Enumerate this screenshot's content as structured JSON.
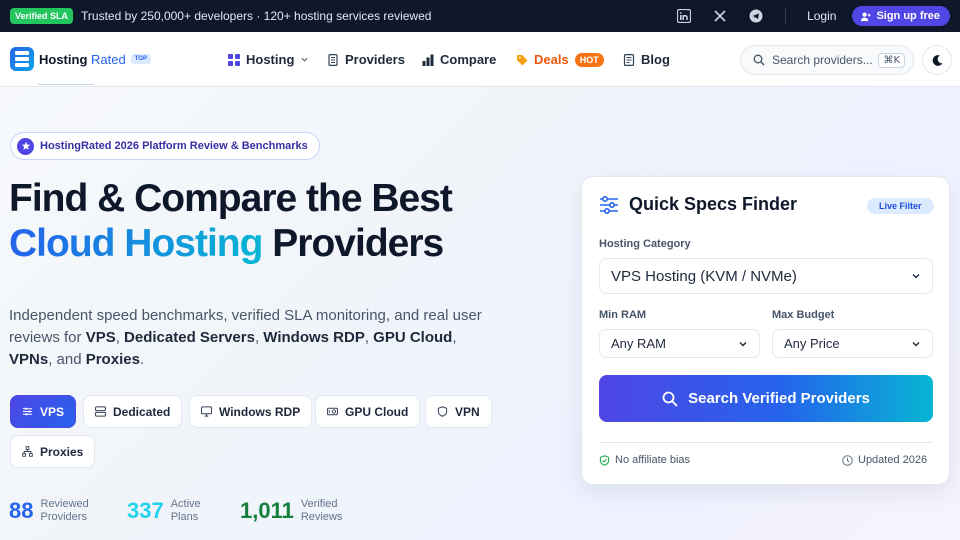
{
  "topbar": {
    "badge": "Verified SLA",
    "trust_text": "Trusted by 250,000+ developers · 120+ hosting services reviewed",
    "social_icons": [
      "linkedin-icon",
      "x-icon",
      "telegram-icon"
    ],
    "login_label": "Login",
    "signup_label": "Sign up free"
  },
  "nav": {
    "logo_primary": "Hosting",
    "logo_secondary": "Rated",
    "logo_badge": "TOP",
    "items": [
      {
        "label": "Hosting",
        "icon": "grid-icon"
      },
      {
        "label": "Providers",
        "icon": "server-icon"
      },
      {
        "label": "Compare",
        "icon": "bar-chart-icon"
      },
      {
        "label": "Deals",
        "icon": "tag-icon",
        "badge": "HOT"
      },
      {
        "label": "Blog",
        "icon": "document-icon"
      }
    ],
    "search_placeholder": "Search providers...",
    "search_shortcut": "⌘K"
  },
  "hero": {
    "pill": "HostingRated 2026 Platform Review & Benchmarks",
    "title_line1": "Find & Compare the Best",
    "title_highlight": "Cloud Hosting",
    "title_rest": "Providers",
    "desc_intro": "Independent speed benchmarks, verified SLA monitoring, and real user reviews for ",
    "desc_terms": [
      "VPS",
      "Dedicated Servers",
      "Windows RDP",
      "GPU Cloud",
      "VPNs",
      "Proxies"
    ],
    "desc_sep1": ", ",
    "desc_sep_last": ", and ",
    "desc_end": ".",
    "chips": [
      {
        "label": "VPS",
        "active": true
      },
      {
        "label": "Dedicated",
        "active": false
      },
      {
        "label": "Windows RDP",
        "active": false
      },
      {
        "label": "GPU Cloud",
        "active": false
      },
      {
        "label": "VPN",
        "active": false
      },
      {
        "label": "Proxies",
        "active": false
      }
    ],
    "stats": [
      {
        "value": "88",
        "label1": "Reviewed",
        "label2": "Providers",
        "color": "#2563eb"
      },
      {
        "value": "337",
        "label1": "Active",
        "label2": "Plans",
        "color": "#22d3ee"
      },
      {
        "value": "1,011",
        "label1": "Verified",
        "label2": "Reviews",
        "color": "#15803d"
      }
    ]
  },
  "finder": {
    "title": "Quick Specs Finder",
    "badge": "Live Filter",
    "category_label": "Hosting Category",
    "category_value": "VPS Hosting (KVM / NVMe)",
    "ram_label": "Min RAM",
    "ram_value": "Any RAM",
    "budget_label": "Max Budget",
    "budget_value": "Any Price",
    "button_label": "Search Verified Providers",
    "footer_left": "No affiliate bias",
    "footer_right": "Updated 2026"
  },
  "colors": {
    "accent": "#4f46e5",
    "brand_blue": "#2563eb",
    "cyan": "#06b6d4",
    "hot": "#f97316",
    "sla_green": "#22c55e"
  }
}
